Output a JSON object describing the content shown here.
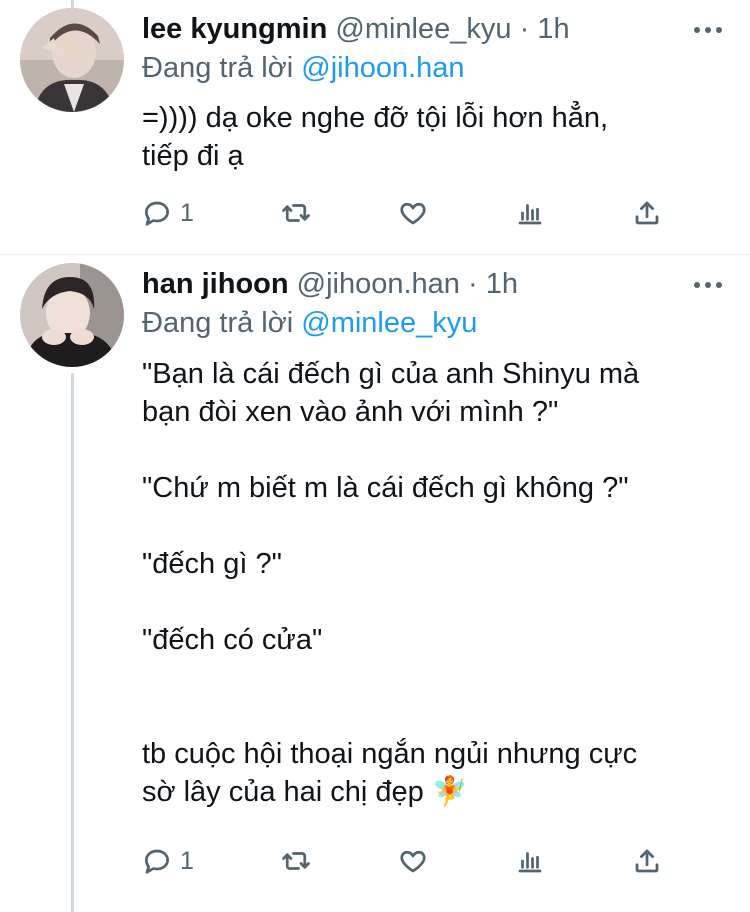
{
  "tweets": [
    {
      "name": "lee kyungmin",
      "handle": "@minlee_kyu",
      "dot": "·",
      "time": "1h",
      "replying_prefix": "Đang trả lời",
      "replying_to": "@jihoon.han",
      "text": "=)))) dạ oke nghe đỡ tội lỗi hơn hẳn,\ntiếp đi ạ",
      "reply_count": "1",
      "avatar_colors": [
        "#6b5a55",
        "#d9cbc4"
      ]
    },
    {
      "name": "han jihoon",
      "handle": "@jihoon.han",
      "dot": "·",
      "time": "1h",
      "replying_prefix": "Đang trả lời",
      "replying_to": "@minlee_kyu",
      "text_lines": [
        "\"Bạn là cái đếch gì của anh Shinyu mà\nbạn đòi xen vào ảnh với mình ?\"",
        "\"Chứ m biết m là cái đếch gì không ?\"",
        "\"đếch gì ?\"",
        "\"đếch có cửa\"",
        "tb cuộc hội thoại ngắn ngủi nhưng cực\nsờ lây của hai chị đẹp 🧚"
      ],
      "reply_count": "1",
      "avatar_colors": [
        "#2d2a2b",
        "#e8d7cf"
      ]
    }
  ],
  "icons": {
    "reply": "comment-icon",
    "retweet": "retweet-icon",
    "like": "heart-icon",
    "analytics": "analytics-icon",
    "share": "share-icon",
    "more": "more-dots-icon"
  },
  "colors": {
    "mention": "#1d9bf0",
    "secondary": "#536471",
    "thread": "#cfd9de"
  }
}
